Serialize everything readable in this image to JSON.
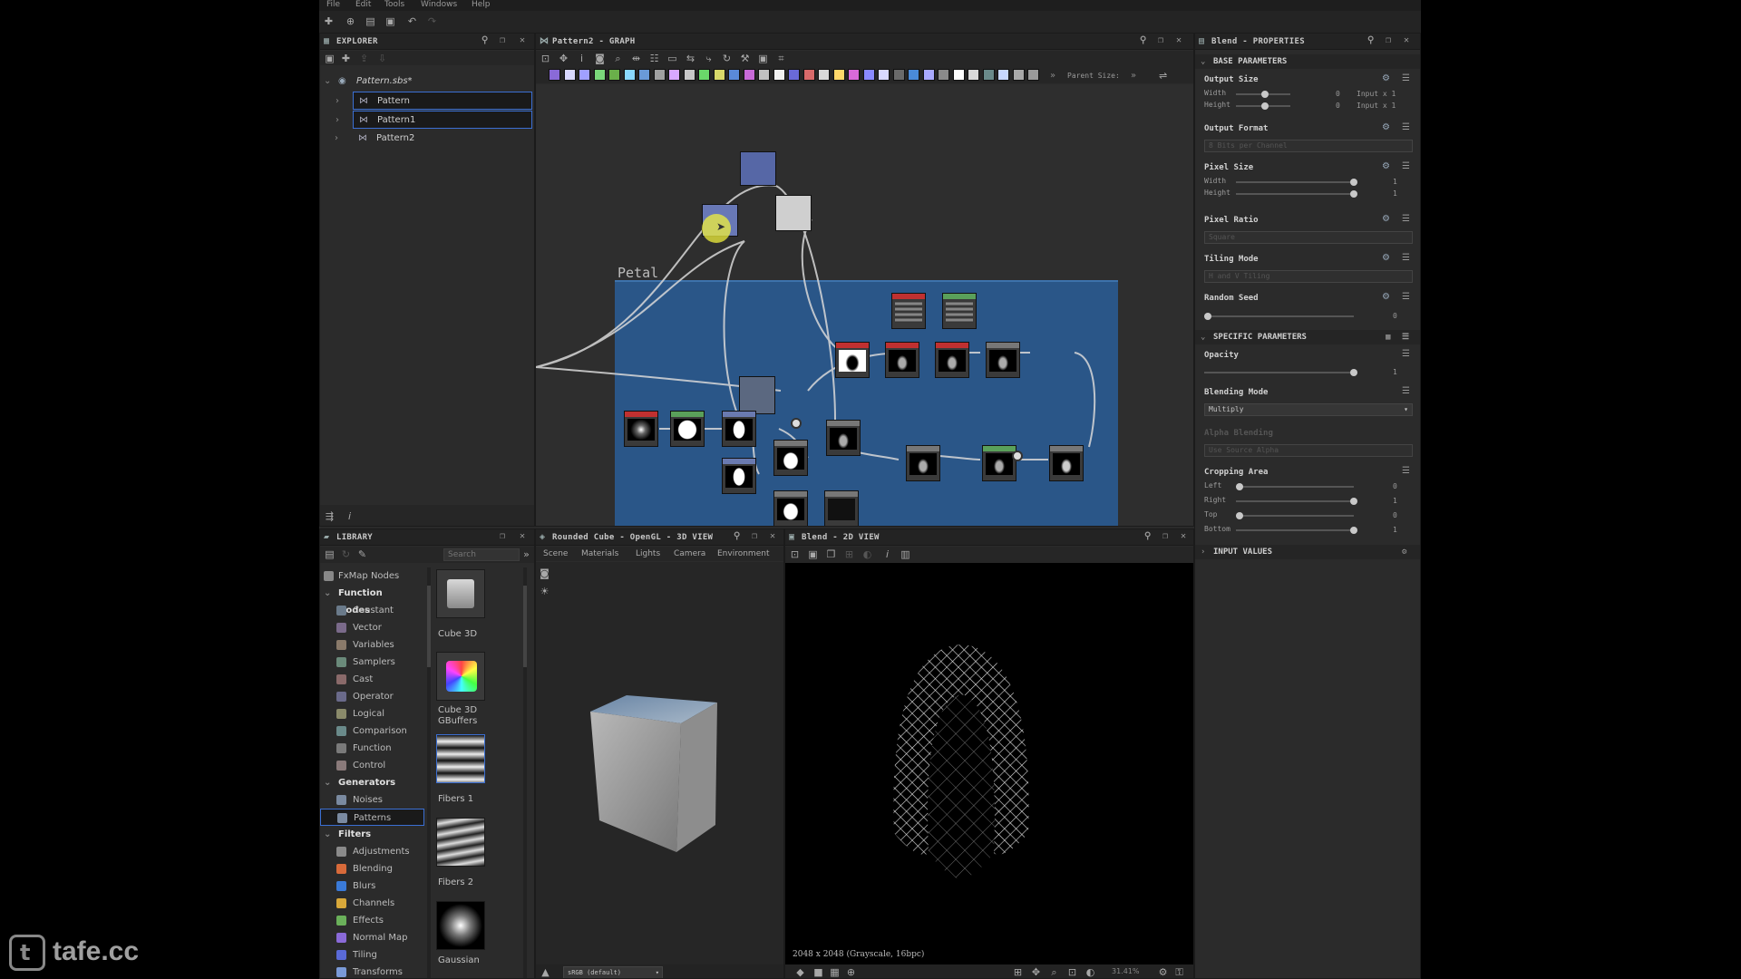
{
  "menu": [
    "File",
    "Edit",
    "Tools",
    "Windows",
    "Help"
  ],
  "explorer": {
    "title": "EXPLORER",
    "package": "Pattern.sbs*",
    "graphs": [
      "Pattern",
      "Pattern1",
      "Pattern2"
    ]
  },
  "graph": {
    "title": "Pattern2 - GRAPH",
    "frame_label": "Petal",
    "parent_size_label": "Parent Size:"
  },
  "properties": {
    "title": "Blend - PROPERTIES",
    "base_section": "BASE PARAMETERS",
    "output_size": {
      "label": "Output Size",
      "width_label": "Width",
      "height_label": "Height",
      "width_value": "0",
      "height_value": "0",
      "width_mode": "Input x 1",
      "height_mode": "Input x 1"
    },
    "output_format": {
      "label": "Output Format",
      "value": "8 Bits per Channel"
    },
    "pixel_size": {
      "label": "Pixel Size",
      "width_label": "Width",
      "height_label": "Height",
      "width_value": "1",
      "height_value": "1"
    },
    "pixel_ratio": {
      "label": "Pixel Ratio",
      "value": "Square"
    },
    "tiling_mode": {
      "label": "Tiling Mode",
      "value": "H and V Tiling"
    },
    "random_seed": {
      "label": "Random Seed",
      "value": "0"
    },
    "specific_section": "SPECIFIC PARAMETERS",
    "opacity": {
      "label": "Opacity",
      "value": "1"
    },
    "blending_mode": {
      "label": "Blending Mode",
      "value": "Multiply"
    },
    "alpha_blending": {
      "label": "Alpha Blending",
      "value": "Use Source Alpha"
    },
    "cropping": {
      "label": "Cropping Area",
      "left_label": "Left",
      "right_label": "Right",
      "top_label": "Top",
      "bottom_label": "Bottom",
      "left": "0",
      "right": "1",
      "top": "0",
      "bottom": "1"
    },
    "input_values": "INPUT VALUES"
  },
  "library": {
    "title": "LIBRARY",
    "search_placeholder": "Search",
    "fxmap": "FxMap Nodes",
    "function_nodes": "Function Nodes",
    "function_items": [
      "Constant",
      "Vector",
      "Variables",
      "Samplers",
      "Cast",
      "Operator",
      "Logical",
      "Comparison",
      "Function",
      "Control"
    ],
    "generators": "Generators",
    "generator_items": [
      "Noises",
      "Patterns"
    ],
    "filters": "Filters",
    "filter_items": [
      "Adjustments",
      "Blending",
      "Blurs",
      "Channels",
      "Effects",
      "Normal Map",
      "Tiling",
      "Transforms"
    ],
    "thumbs": [
      "Cube 3D",
      "Cube 3D GBuffers",
      "Fibers 1",
      "Fibers 2",
      "Gaussian"
    ]
  },
  "view3d": {
    "title": "Rounded Cube - OpenGL - 3D VIEW",
    "tabs": [
      "Scene",
      "Materials",
      "Lights",
      "Camera",
      "Environment"
    ],
    "colorspace": "sRGB (default)"
  },
  "view2d": {
    "title": "Blend - 2D VIEW",
    "status": "2048 x 2048 (Grayscale, 16bpc)",
    "zoom": "31.41%"
  },
  "watermark": "tafe.cc"
}
